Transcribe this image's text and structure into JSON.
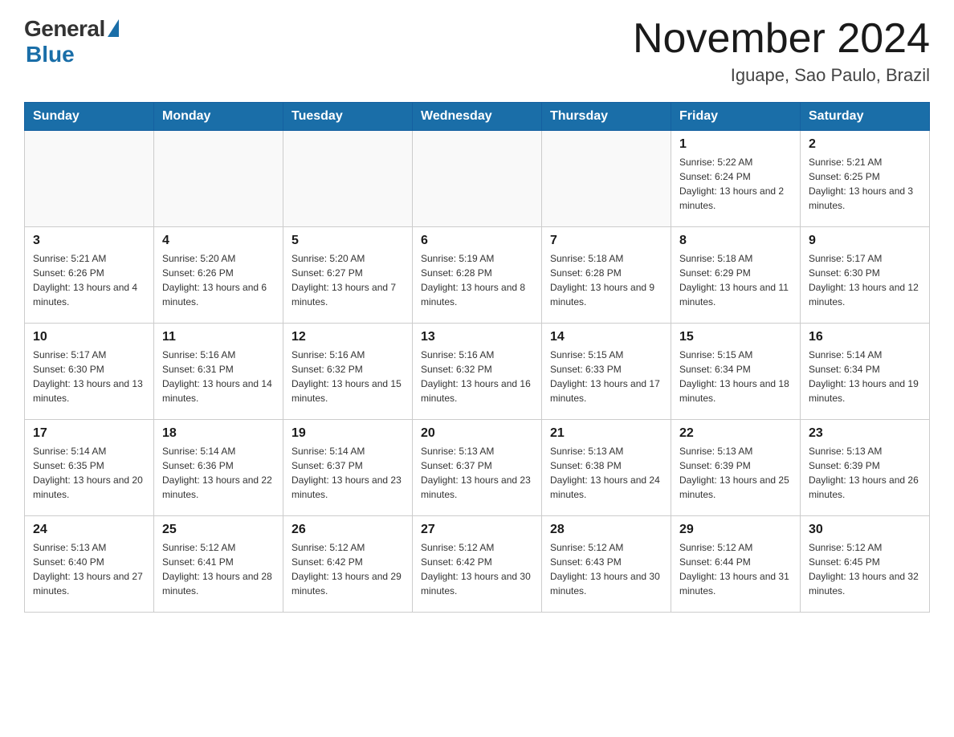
{
  "header": {
    "logo_general": "General",
    "logo_blue": "Blue",
    "title": "November 2024",
    "subtitle": "Iguape, Sao Paulo, Brazil"
  },
  "days_of_week": [
    "Sunday",
    "Monday",
    "Tuesday",
    "Wednesday",
    "Thursday",
    "Friday",
    "Saturday"
  ],
  "weeks": [
    {
      "days": [
        {
          "date": "",
          "info": ""
        },
        {
          "date": "",
          "info": ""
        },
        {
          "date": "",
          "info": ""
        },
        {
          "date": "",
          "info": ""
        },
        {
          "date": "",
          "info": ""
        },
        {
          "date": "1",
          "info": "Sunrise: 5:22 AM\nSunset: 6:24 PM\nDaylight: 13 hours and 2 minutes."
        },
        {
          "date": "2",
          "info": "Sunrise: 5:21 AM\nSunset: 6:25 PM\nDaylight: 13 hours and 3 minutes."
        }
      ]
    },
    {
      "days": [
        {
          "date": "3",
          "info": "Sunrise: 5:21 AM\nSunset: 6:26 PM\nDaylight: 13 hours and 4 minutes."
        },
        {
          "date": "4",
          "info": "Sunrise: 5:20 AM\nSunset: 6:26 PM\nDaylight: 13 hours and 6 minutes."
        },
        {
          "date": "5",
          "info": "Sunrise: 5:20 AM\nSunset: 6:27 PM\nDaylight: 13 hours and 7 minutes."
        },
        {
          "date": "6",
          "info": "Sunrise: 5:19 AM\nSunset: 6:28 PM\nDaylight: 13 hours and 8 minutes."
        },
        {
          "date": "7",
          "info": "Sunrise: 5:18 AM\nSunset: 6:28 PM\nDaylight: 13 hours and 9 minutes."
        },
        {
          "date": "8",
          "info": "Sunrise: 5:18 AM\nSunset: 6:29 PM\nDaylight: 13 hours and 11 minutes."
        },
        {
          "date": "9",
          "info": "Sunrise: 5:17 AM\nSunset: 6:30 PM\nDaylight: 13 hours and 12 minutes."
        }
      ]
    },
    {
      "days": [
        {
          "date": "10",
          "info": "Sunrise: 5:17 AM\nSunset: 6:30 PM\nDaylight: 13 hours and 13 minutes."
        },
        {
          "date": "11",
          "info": "Sunrise: 5:16 AM\nSunset: 6:31 PM\nDaylight: 13 hours and 14 minutes."
        },
        {
          "date": "12",
          "info": "Sunrise: 5:16 AM\nSunset: 6:32 PM\nDaylight: 13 hours and 15 minutes."
        },
        {
          "date": "13",
          "info": "Sunrise: 5:16 AM\nSunset: 6:32 PM\nDaylight: 13 hours and 16 minutes."
        },
        {
          "date": "14",
          "info": "Sunrise: 5:15 AM\nSunset: 6:33 PM\nDaylight: 13 hours and 17 minutes."
        },
        {
          "date": "15",
          "info": "Sunrise: 5:15 AM\nSunset: 6:34 PM\nDaylight: 13 hours and 18 minutes."
        },
        {
          "date": "16",
          "info": "Sunrise: 5:14 AM\nSunset: 6:34 PM\nDaylight: 13 hours and 19 minutes."
        }
      ]
    },
    {
      "days": [
        {
          "date": "17",
          "info": "Sunrise: 5:14 AM\nSunset: 6:35 PM\nDaylight: 13 hours and 20 minutes."
        },
        {
          "date": "18",
          "info": "Sunrise: 5:14 AM\nSunset: 6:36 PM\nDaylight: 13 hours and 22 minutes."
        },
        {
          "date": "19",
          "info": "Sunrise: 5:14 AM\nSunset: 6:37 PM\nDaylight: 13 hours and 23 minutes."
        },
        {
          "date": "20",
          "info": "Sunrise: 5:13 AM\nSunset: 6:37 PM\nDaylight: 13 hours and 23 minutes."
        },
        {
          "date": "21",
          "info": "Sunrise: 5:13 AM\nSunset: 6:38 PM\nDaylight: 13 hours and 24 minutes."
        },
        {
          "date": "22",
          "info": "Sunrise: 5:13 AM\nSunset: 6:39 PM\nDaylight: 13 hours and 25 minutes."
        },
        {
          "date": "23",
          "info": "Sunrise: 5:13 AM\nSunset: 6:39 PM\nDaylight: 13 hours and 26 minutes."
        }
      ]
    },
    {
      "days": [
        {
          "date": "24",
          "info": "Sunrise: 5:13 AM\nSunset: 6:40 PM\nDaylight: 13 hours and 27 minutes."
        },
        {
          "date": "25",
          "info": "Sunrise: 5:12 AM\nSunset: 6:41 PM\nDaylight: 13 hours and 28 minutes."
        },
        {
          "date": "26",
          "info": "Sunrise: 5:12 AM\nSunset: 6:42 PM\nDaylight: 13 hours and 29 minutes."
        },
        {
          "date": "27",
          "info": "Sunrise: 5:12 AM\nSunset: 6:42 PM\nDaylight: 13 hours and 30 minutes."
        },
        {
          "date": "28",
          "info": "Sunrise: 5:12 AM\nSunset: 6:43 PM\nDaylight: 13 hours and 30 minutes."
        },
        {
          "date": "29",
          "info": "Sunrise: 5:12 AM\nSunset: 6:44 PM\nDaylight: 13 hours and 31 minutes."
        },
        {
          "date": "30",
          "info": "Sunrise: 5:12 AM\nSunset: 6:45 PM\nDaylight: 13 hours and 32 minutes."
        }
      ]
    }
  ]
}
